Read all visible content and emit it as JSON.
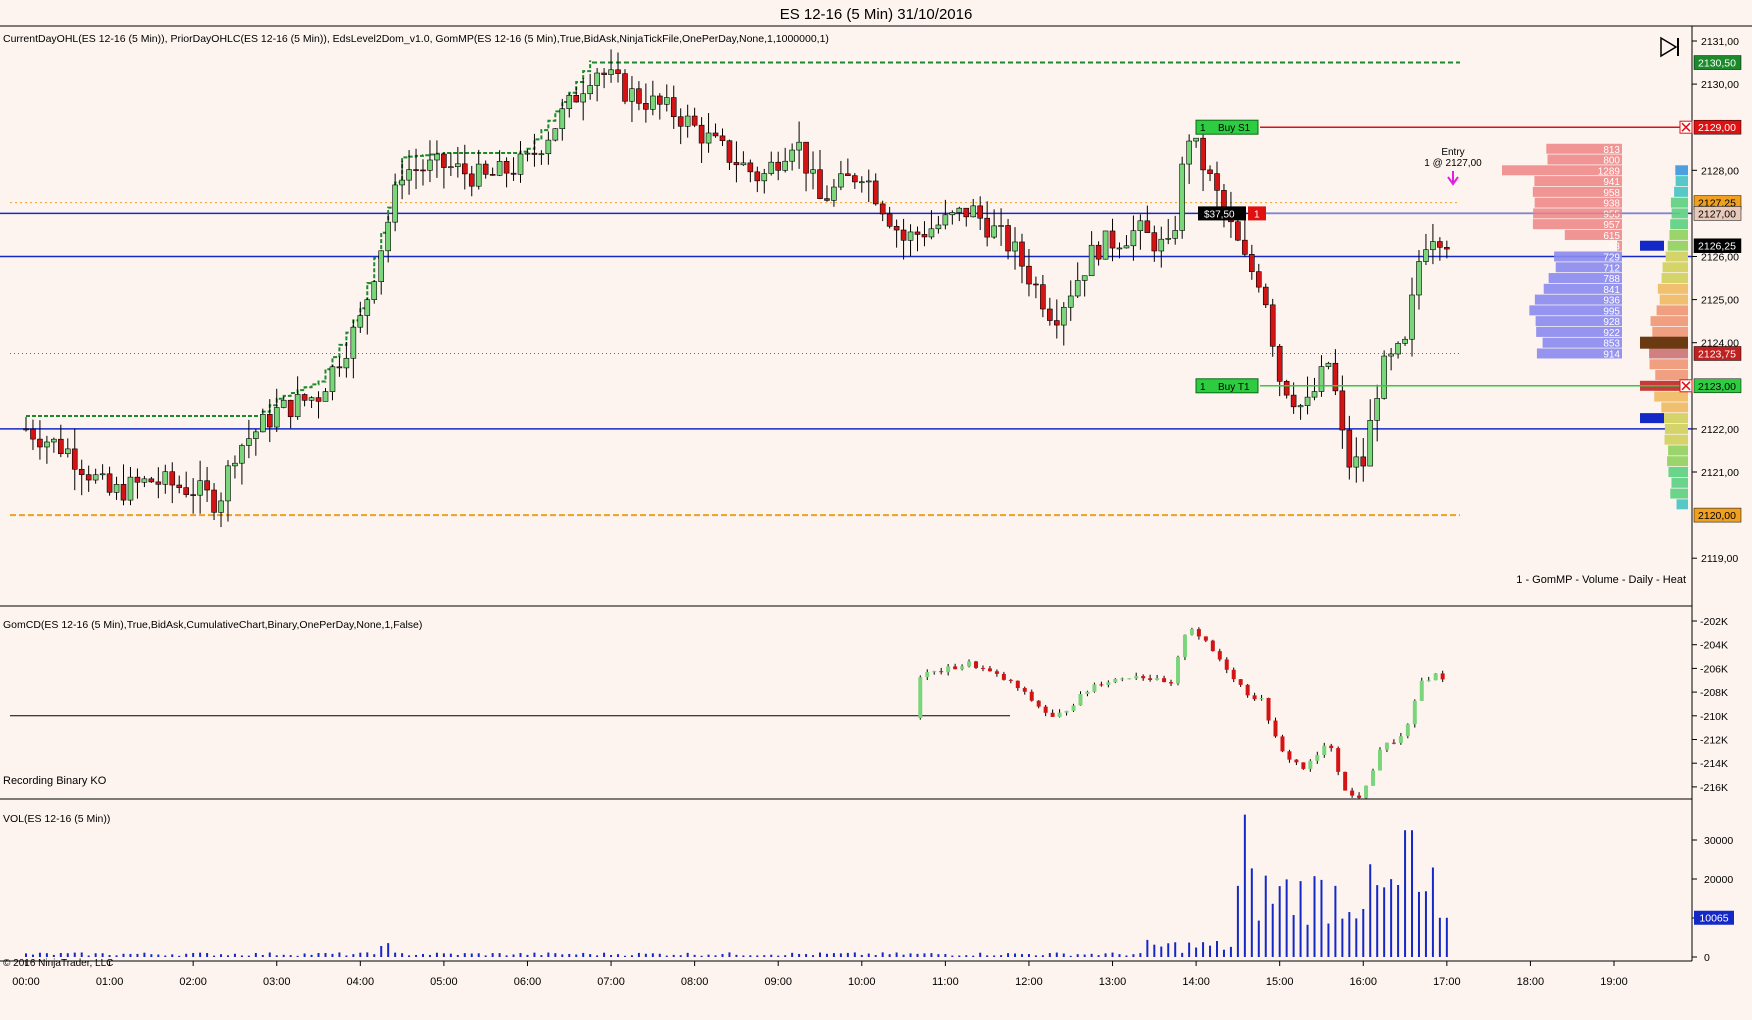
{
  "window": {
    "title": "ES 12-16 (5 Min)  31/10/2016"
  },
  "panels": {
    "price": {
      "indicator_text": "CurrentDayOHL(ES 12-16 (5 Min)), PriorDayOHLC(ES 12-16 (5 Min)), EdsLevel2Dom_v1.0, GomMP(ES 12-16 (5 Min),True,BidAsk,NinjaTickFile,OnePerDay,None,1,1000000,1)",
      "footer_label": "1 - GomMP  - Volume - Daily - Heat"
    },
    "cd": {
      "indicator_text": "GomCD(ES 12-16 (5 Min),True,BidAsk,CumulativeChart,Binary,OnePerDay,None,1,False)",
      "status_text": "Recording Binary KO"
    },
    "vol": {
      "indicator_text": "VOL(ES 12-16 (5 Min))",
      "copyright": "© 2016 NinjaTrader, LLC"
    }
  },
  "orders": {
    "stop": {
      "qty": "1",
      "label": "Buy  S1",
      "price": 2129.0
    },
    "target": {
      "qty": "1",
      "label": "Buy  T1",
      "price": 2123.0
    },
    "position": {
      "pnl": "$37,50",
      "qty": "1",
      "price": 2127.0
    },
    "entry_label": "Entry",
    "entry_detail": "1 @ 2127,00"
  },
  "price_tags": [
    {
      "text": "2130,50",
      "color": "#1a8a2a",
      "text_color": "#ffffff"
    },
    {
      "text": "2129,00",
      "color": "#e01010",
      "text_color": "#ffffff"
    },
    {
      "text": "2127,25",
      "color": "#f0a020",
      "text_color": "#000000"
    },
    {
      "text": "2127,00",
      "color": "#e6c9b8",
      "text_color": "#000000"
    },
    {
      "text": "2126,25",
      "color": "#000000",
      "text_color": "#ffffff"
    },
    {
      "text": "2123,75",
      "color": "#c02020",
      "text_color": "#ffffff"
    },
    {
      "text": "2123,00",
      "color": "#2ecc40",
      "text_color": "#000000"
    },
    {
      "text": "2120,00",
      "color": "#f0a020",
      "text_color": "#000000"
    }
  ],
  "vol_tag": {
    "text": "10065",
    "color": "#1428c8"
  },
  "chart_data": [
    {
      "type": "candlestick",
      "title": "ES 12-16 (5 Min)  31/10/2016",
      "y_ticks": [
        "2131,00",
        "2130,00",
        "2128,00",
        "2126,00",
        "2125,00",
        "2124,00",
        "2122,00",
        "2121,00",
        "2119,00"
      ],
      "y_tick_values": [
        2131,
        2130,
        2128,
        2126,
        2125,
        2124,
        2122,
        2121,
        2119
      ],
      "ylim": [
        2118.1,
        2131.3
      ],
      "x_ticks": [
        "00:00",
        "01:00",
        "02:00",
        "03:00",
        "04:00",
        "05:00",
        "06:00",
        "07:00",
        "08:00",
        "09:00",
        "10:00",
        "11:00",
        "12:00",
        "13:00",
        "14:00",
        "15:00",
        "16:00",
        "17:00",
        "18:00",
        "19:00"
      ],
      "x_range_hours": [
        -0.13,
        20.0
      ],
      "levels": [
        {
          "name": "prior-high",
          "value": 2127.0,
          "color": "#1428c8"
        },
        {
          "name": "prior-low",
          "value": 2122.0,
          "color": "#1428c8"
        },
        {
          "name": "prior-close",
          "value": 2126.0,
          "color": "#1428c8"
        },
        {
          "name": "current-high",
          "value": 2130.5,
          "color": "#1a8a2a"
        },
        {
          "name": "current-low",
          "value": 2120.0,
          "color": "#f0a020"
        }
      ],
      "ohlc_anchors_hours": [
        0,
        0.5,
        1,
        1.5,
        2,
        2.3,
        2.5,
        3,
        3.5,
        4,
        4.5,
        5,
        5.5,
        6,
        6.5,
        6.8,
        7.2,
        7.8,
        8.3,
        8.8,
        9.2,
        9.5,
        10,
        10.5,
        11,
        11.3,
        11.8,
        12.3,
        12.8,
        13.3,
        13.7,
        13.9,
        14.3,
        14.6,
        14.8,
        15,
        15.3,
        15.6,
        15.8,
        16,
        16.2,
        16.5,
        16.7,
        16.85,
        17
      ],
      "ohlc_anchors_values": [
        2122,
        2121.5,
        2120.5,
        2120.8,
        2120.6,
        2120.3,
        2121.5,
        2122.4,
        2122.8,
        2124.5,
        2128,
        2128.1,
        2127.8,
        2128.2,
        2129.5,
        2130.4,
        2129.8,
        2129.3,
        2128.5,
        2127.8,
        2128.8,
        2127.3,
        2128,
        2126.4,
        2126.8,
        2127.1,
        2126.2,
        2124.6,
        2126.2,
        2126.6,
        2126.1,
        2128.9,
        2127.2,
        2125.8,
        2125.4,
        2123.2,
        2122.4,
        2123.6,
        2121.2,
        2121.2,
        2123.3,
        2123.9,
        2126.3,
        2126.6,
        2126.4
      ],
      "volume_profile": {
        "bid_ask_levels": [
          "813",
          "800",
          "1289",
          "941",
          "958",
          "938",
          "955",
          "957",
          "615",
          "53",
          "729",
          "712",
          "788",
          "841",
          "936",
          "995",
          "928",
          "922",
          "853",
          "914"
        ],
        "prices_start": 2128.5,
        "step": 0.25
      }
    },
    {
      "type": "candlestick",
      "title": "GomCD",
      "y_ticks": [
        "-202K",
        "-204K",
        "-206K",
        "-208K",
        "-210K",
        "-212K",
        "-214K",
        "-216K"
      ],
      "y_tick_values": [
        -202,
        -204,
        -206,
        -208,
        -210,
        -212,
        -214,
        -216
      ],
      "ylim": [
        -217,
        -201
      ]
    },
    {
      "type": "bar",
      "title": "VOL(ES 12-16 (5 Min))",
      "y_ticks": [
        "30000",
        "20000",
        "10000",
        "0"
      ],
      "y_tick_values": [
        30000,
        20000,
        10000,
        0
      ],
      "ylim": [
        0,
        37000
      ],
      "last_value": 10065
    }
  ]
}
